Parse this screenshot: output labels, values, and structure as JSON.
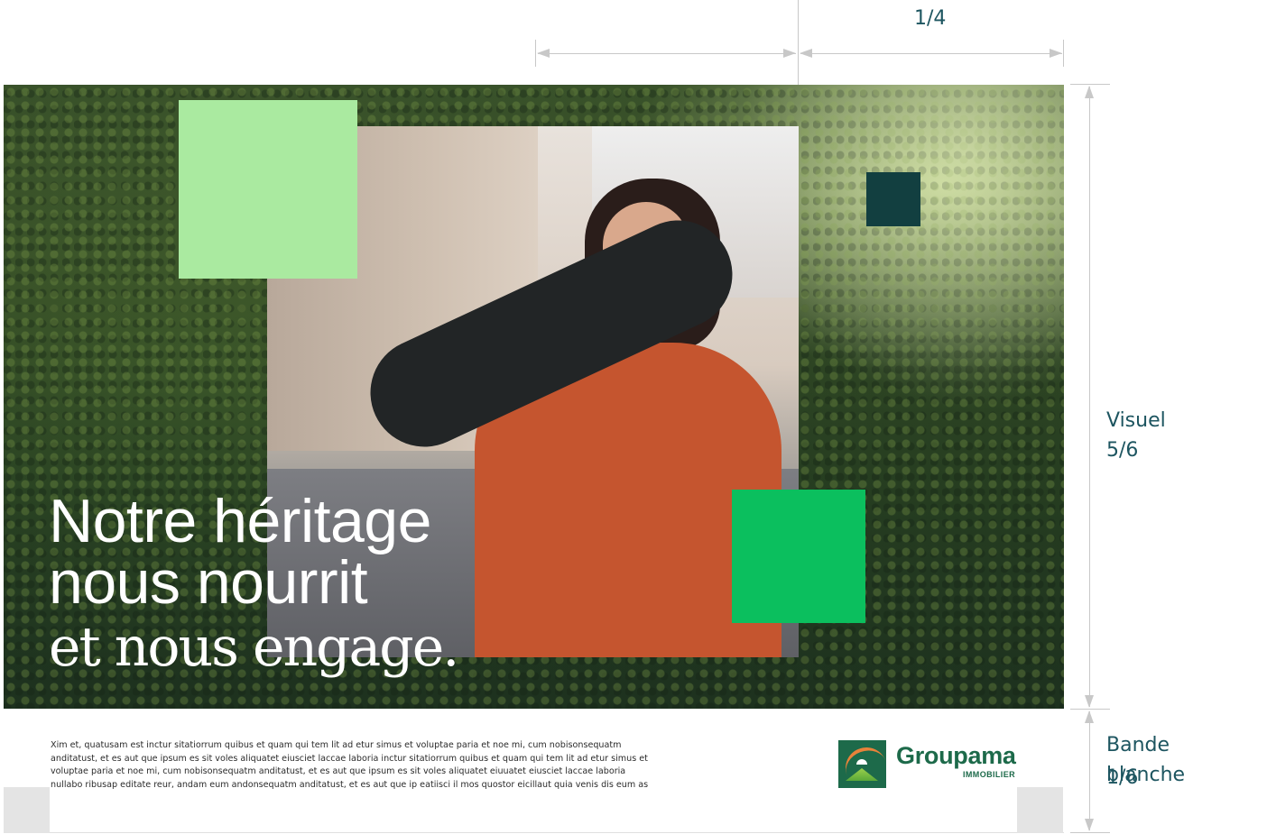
{
  "dimensions": {
    "top_fraction_label": "1/4",
    "visual_label": "Visuel 5/6",
    "band_label_line1": "Bande blanche",
    "band_label_line2": "1/6"
  },
  "headline": {
    "line1": "Notre héritage",
    "line2": "nous nourrit",
    "line3": "et nous engage."
  },
  "body_copy": "Xim et, quatusam est inctur sitatiorrum quibus et quam qui tem lit ad etur simus et voluptae paria et noe mi, cum nobisonsequatm anditatust, et es aut que ipsum es sit voles aliquatet eiusciet laccae laboria inctur sitatiorrum quibus et quam qui tem lit ad etur simus et voluptae paria et noe mi, cum nobisonsequatm anditatust, et es aut que ipsum es sit voles aliquatet eiuuatet eiusciet laccae laboria nullabo ribusap editate reur, andam eum andonsequatm anditatust, et es aut que ip eatiisci il mos quostor eicillaut quia venis dis eum as",
  "logo": {
    "name": "Groupama",
    "subtitle": "IMMOBILIER"
  },
  "colors": {
    "light_green": "#aaeaa0",
    "dark_teal": "#123f40",
    "bright_green": "#0bbf5e",
    "brand_green": "#1d6a4a",
    "guide_gray": "#c8c8c8",
    "label_teal": "#1d5560"
  },
  "icons": {
    "logo_mark": "groupama-logo-icon"
  }
}
